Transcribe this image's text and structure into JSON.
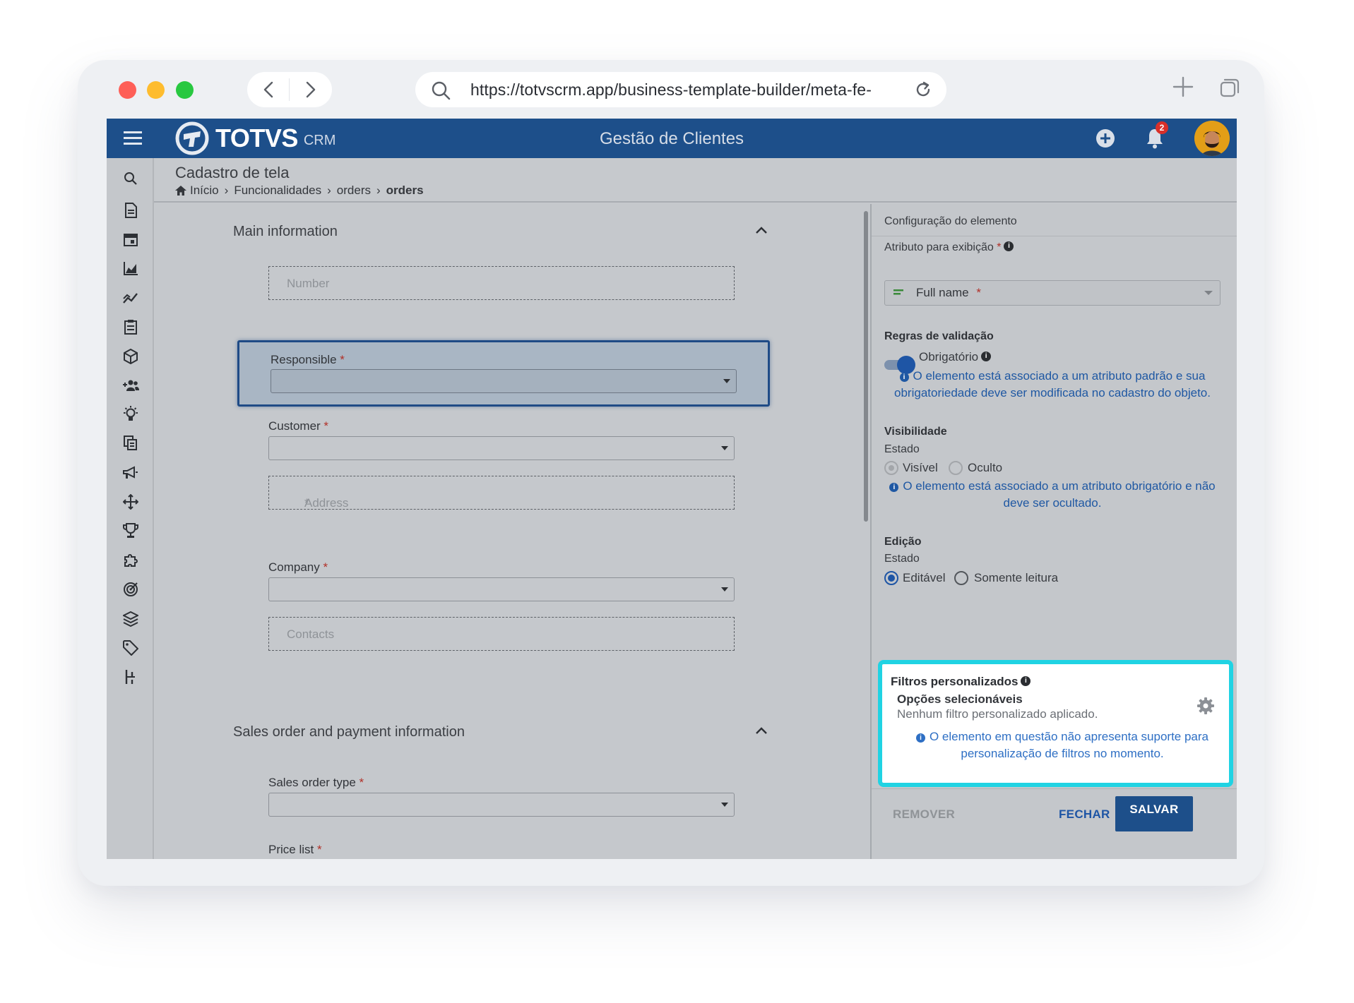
{
  "browser": {
    "url": "https://totvscrm.app/business-template-builder/meta-fe-"
  },
  "header": {
    "logo_text": "TOTVS",
    "logo_sub": "CRM",
    "app_title": "Gestão de Clientes",
    "notification_count": "2",
    "colors": {
      "topbar": "#1d4f8a",
      "accent": "#20d3e3"
    }
  },
  "sidebar": {
    "icons": [
      "search-icon",
      "document-icon",
      "calendar-icon",
      "area-chart-icon",
      "trend-icon",
      "clipboard-icon",
      "box-icon",
      "add-group-icon",
      "lightbulb-icon",
      "copy-icon",
      "megaphone-icon",
      "move-icon",
      "trophy-icon",
      "puzzle-icon",
      "target-icon",
      "layers-icon",
      "tag-icon",
      "workflow-icon"
    ]
  },
  "page": {
    "title": "Cadastro de tela",
    "breadcrumb": [
      "Início",
      "Funcionalidades",
      "orders",
      "orders"
    ]
  },
  "form": {
    "section1": "Main information",
    "number_placeholder": "Number",
    "responsible_label": "Responsible",
    "customer_label": "Customer",
    "address_placeholder": "Address",
    "company_label": "Company",
    "contacts_placeholder": "Contacts",
    "section2": "Sales order and payment information",
    "sales_order_type_label": "Sales order type",
    "price_list_label": "Price list",
    "required_mark": "*"
  },
  "config": {
    "heading": "Configuração do elemento",
    "attr_label": "Atributo para exibição",
    "attr_value": "Full name",
    "validation_title": "Regras de validação",
    "required_toggle_label": "Obrigatório",
    "validation_note": "O elemento está associado a um atributo padrão e sua obrigatoriedade deve ser modificada no cadastro do objeto.",
    "visibility_title": "Visibilidade",
    "visibility_state_label": "Estado",
    "visible_option": "Visível",
    "hidden_option": "Oculto",
    "visibility_note": "O elemento está associado a um atributo obrigatório e não deve ser ocultado.",
    "edit_title": "Edição",
    "edit_state_label": "Estado",
    "editable_option": "Editável",
    "readonly_option": "Somente leitura",
    "filters_title": "Filtros personalizados",
    "filters_sub": "Opções selecionáveis",
    "filters_desc": "Nenhum filtro personalizado aplicado.",
    "filters_note": "O elemento em questão não apresenta suporte para personalização de filtros no momento."
  },
  "footer": {
    "remove": "REMOVER",
    "close": "FECHAR",
    "save": "SALVAR"
  }
}
